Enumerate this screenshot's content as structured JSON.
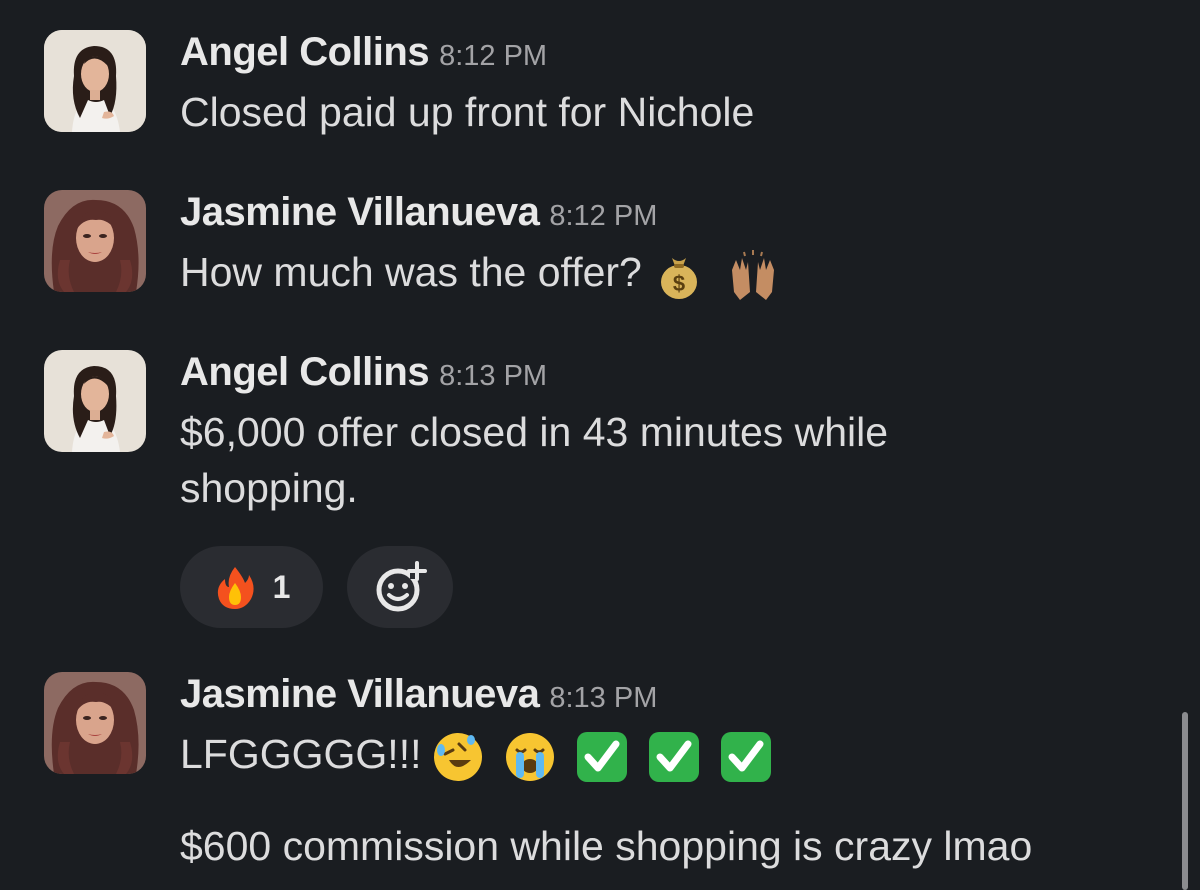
{
  "messages": [
    {
      "author": "Angel Collins",
      "time": "8:12 PM",
      "text": "Closed paid up front for Nichole"
    },
    {
      "author": "Jasmine Villanueva",
      "time": "8:12 PM",
      "text": "How much was the offer?",
      "emojis": [
        "money-bag-icon",
        "raising-hands-icon"
      ]
    },
    {
      "author": "Angel Collins",
      "time": "8:13 PM",
      "text": "$6,000 offer closed in 43 minutes while shopping.",
      "reactions": [
        {
          "emoji": "fire-icon",
          "count": "1"
        }
      ],
      "add_reaction_icon": "add-reaction-icon"
    },
    {
      "author": "Jasmine Villanueva",
      "time": "8:13 PM",
      "text": "LFGGGGG!!!",
      "emojis": [
        "rolling-laughing-icon",
        "loudly-crying-icon",
        "check-mark-icon",
        "check-mark-icon",
        "check-mark-icon"
      ],
      "text2": "$600 commission while shopping is crazy lmao"
    }
  ],
  "colors": {
    "background": "#1a1d21",
    "name": "#e8e8e8",
    "time": "#a3a3a6",
    "text": "#dcdcdd",
    "pill": "#2a2c31"
  }
}
